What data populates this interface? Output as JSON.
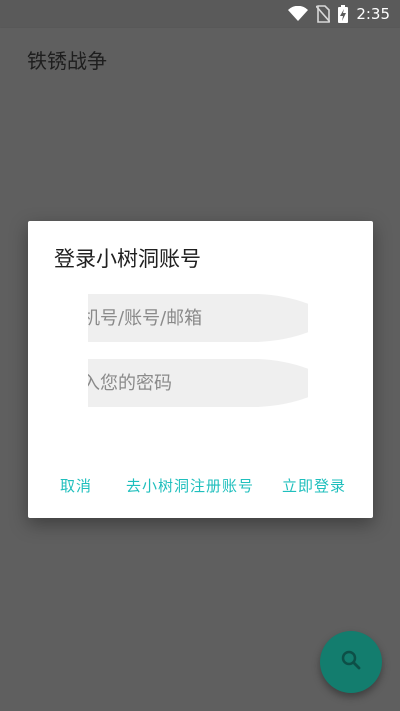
{
  "status_bar": {
    "time": "2:35",
    "icons": [
      "wifi-icon",
      "no-sim-icon",
      "battery-charging-icon"
    ]
  },
  "app_bar": {
    "title": "铁锈战争"
  },
  "dialog": {
    "title": "登录小树洞账号",
    "username_field": {
      "value": "",
      "placeholder": "手机号/账号/邮箱",
      "visible_placeholder": "机号/账号/邮箱"
    },
    "password_field": {
      "value": "",
      "placeholder": "输入您的密码",
      "visible_placeholder": "入您的密码"
    },
    "actions": {
      "cancel_label": "取消",
      "register_label": "去小树洞注册账号",
      "login_label": "立即登录"
    },
    "accent_color": "#1fbfbd"
  },
  "fab": {
    "icon": "search-icon",
    "color": "#137d6e"
  }
}
